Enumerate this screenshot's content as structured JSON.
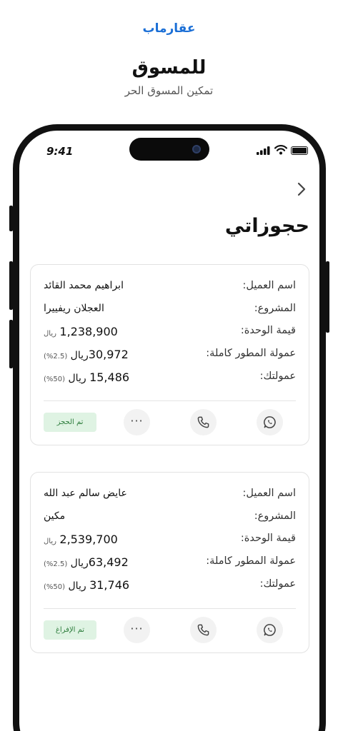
{
  "brand": {
    "logo_text": "عقارماب"
  },
  "hero": {
    "title": "للمسوق",
    "subtitle": "تمكين المسوق الحر"
  },
  "status_bar": {
    "time": "9:41"
  },
  "page": {
    "title": "حجوزاتي"
  },
  "labels": {
    "client": "اسم العميل:",
    "project": "المشروع:",
    "unit_value": "قيمة الوحدة:",
    "developer_commission": "عمولة المطور كاملة:",
    "your_commission": "عمولتك:"
  },
  "bookings": [
    {
      "client": "ابراهيم محمد القائد",
      "project": "العجلان ريفييرا",
      "unit_value": "1,238,900",
      "unit_currency": "ريال",
      "developer_commission": "30,972",
      "developer_currency": "ريال",
      "developer_pct": "(2.5%)",
      "your_commission": "15,486",
      "your_currency": "ريال",
      "your_pct": "(50%)",
      "status": "تم الحجز"
    },
    {
      "client": "عايض سالم عبد الله",
      "project": "مكين",
      "unit_value": "2,539,700",
      "unit_currency": "ريال",
      "developer_commission": "63,492",
      "developer_currency": "ريال",
      "developer_pct": "(2.5%)",
      "your_commission": "31,746",
      "your_currency": "ريال",
      "your_pct": "(50%)",
      "status": "تم الإفراغ"
    }
  ],
  "actions": {
    "more_label": "···"
  },
  "colors": {
    "brand": "#1b6fd6",
    "status_bg": "#dff3e3",
    "status_text": "#2e7d3d"
  },
  "icons": [
    "chevron-right-icon",
    "whatsapp-icon",
    "phone-icon",
    "more-icon",
    "signal-icon",
    "wifi-icon",
    "battery-icon"
  ]
}
